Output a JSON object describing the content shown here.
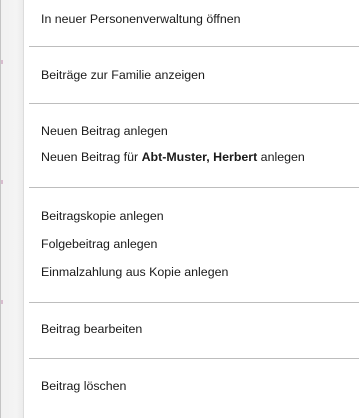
{
  "menu": {
    "open_in_new_person_admin": "In neuer Personenverwaltung öffnen",
    "show_family_contributions": "Beiträge zur Familie anzeigen",
    "new_contribution": "Neuen Beitrag anlegen",
    "new_contribution_for_prefix": "Neuen Beitrag für ",
    "new_contribution_for_name": "Abt-Muster, Herbert",
    "new_contribution_for_suffix": " anlegen",
    "copy_contribution": "Beitragskopie anlegen",
    "follow_up_contribution": "Folgebeitrag anlegen",
    "one_time_payment_from_copy": "Einmalzahlung aus Kopie anlegen",
    "edit_contribution": "Beitrag bearbeiten",
    "delete_contribution": "Beitrag löschen"
  }
}
